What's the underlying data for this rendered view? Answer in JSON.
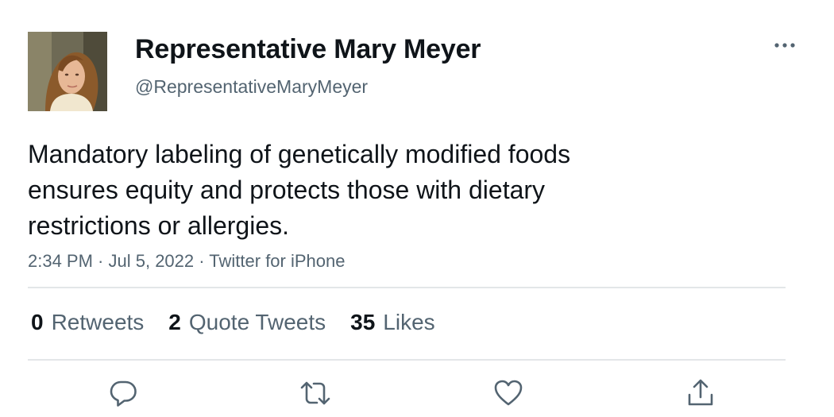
{
  "author": {
    "display_name": "Representative Mary Meyer",
    "handle": "@RepresentativeMaryMeyer"
  },
  "tweet": {
    "text": "Mandatory labeling of genetically modified foods ensures equity and protects those with dietary restrictions or allergies.",
    "time": "2:34 PM",
    "date": "Jul 5, 2022",
    "source": "Twitter for iPhone",
    "separator": " · "
  },
  "stats": {
    "retweets": {
      "count": "0",
      "label": "Retweets"
    },
    "quote_tweets": {
      "count": "2",
      "label": "Quote Tweets"
    },
    "likes": {
      "count": "35",
      "label": "Likes"
    }
  },
  "icons": {
    "more": "more-horizontal-icon",
    "reply": "reply-icon",
    "retweet": "retweet-icon",
    "like": "heart-icon",
    "share": "share-icon"
  },
  "colors": {
    "text_primary": "#0f1419",
    "text_secondary": "#536471",
    "divider": "#e3e6e8",
    "background": "#ffffff"
  }
}
